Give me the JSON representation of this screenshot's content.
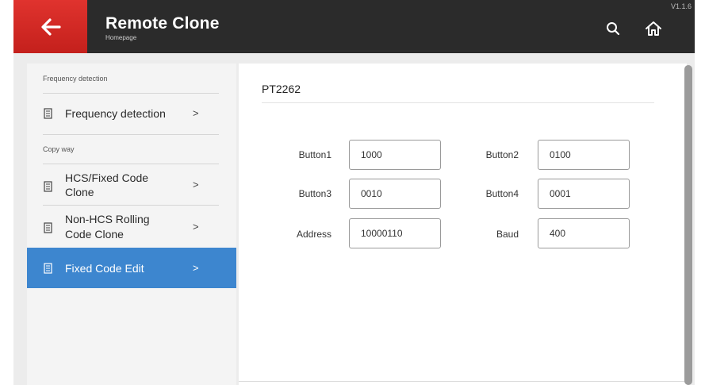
{
  "header": {
    "title": "Remote Clone",
    "subtitle": "Homepage",
    "version": "V1.1.6",
    "icons": {
      "back": "arrow-left-icon",
      "search": "search-icon",
      "home": "home-icon"
    }
  },
  "sidebar": {
    "section1": "Frequency detection",
    "section2": "Copy way",
    "items": [
      {
        "label": "Frequency detection",
        "icon": "document-icon",
        "active": false
      },
      {
        "label1": "HCS/Fixed Code",
        "label2": "Clone",
        "icon": "document-icon",
        "active": false
      },
      {
        "label1": "Non-HCS Rolling",
        "label2": "Code Clone",
        "icon": "document-icon",
        "active": false
      },
      {
        "label": "Fixed Code Edit",
        "icon": "document-icon",
        "active": true
      }
    ],
    "chevron": ">"
  },
  "content": {
    "model": "PT2262",
    "fields": [
      {
        "label": "Button1",
        "value": "1000"
      },
      {
        "label": "Button2",
        "value": "0100"
      },
      {
        "label": "Button3",
        "value": "0010"
      },
      {
        "label": "Button4",
        "value": "0001"
      },
      {
        "label": "Address",
        "value": "10000110"
      },
      {
        "label": "Baud",
        "value": "400"
      }
    ]
  },
  "colors": {
    "header_bg": "#2b2b2b",
    "back_button_red": "#d42a25",
    "active_item_blue": "#3d86cf"
  }
}
